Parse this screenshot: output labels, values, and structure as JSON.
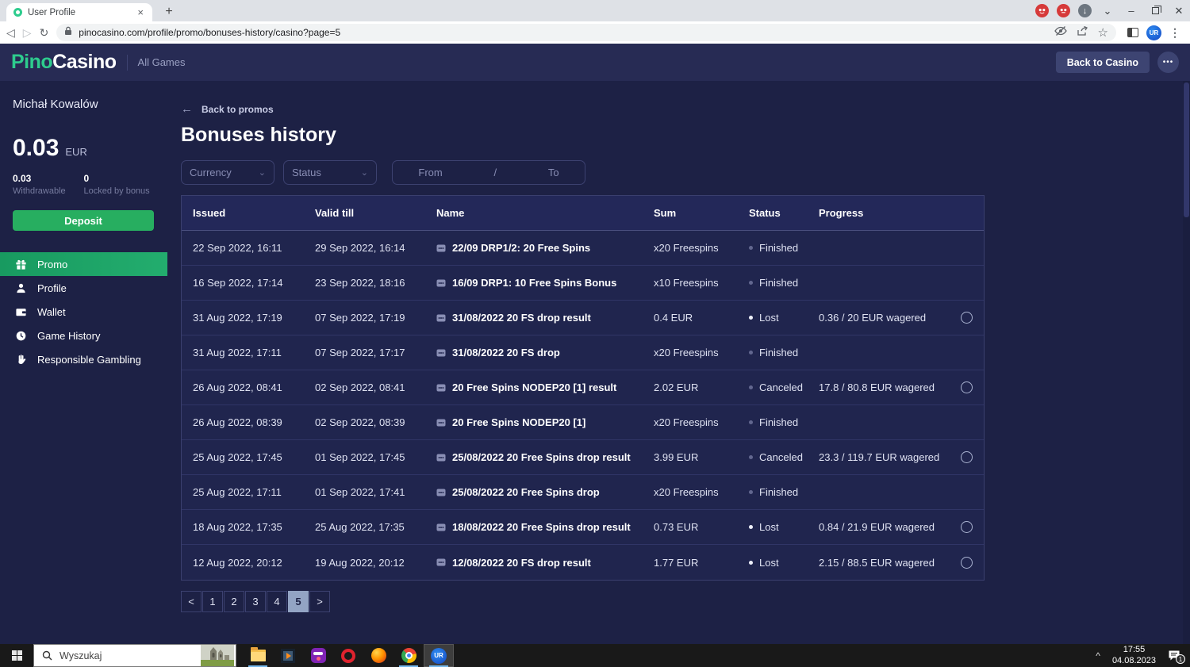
{
  "browser": {
    "tab_title": "User Profile",
    "url": "pinocasino.com/profile/promo/bonuses-history/casino?page=5"
  },
  "icons": {
    "tab_close": "×",
    "new_tab": "+",
    "tab_search_chevron": "⌄",
    "window_minimize": "–",
    "window_close": "✕",
    "back": "◁",
    "forward": "▷",
    "reload": "↻",
    "download_arrow": "↓",
    "star": "☆",
    "kebab": "⋮",
    "more_dots": "•••",
    "back_arrow": "←",
    "chevron_down": "⌄",
    "tray_chevron": "^"
  },
  "header": {
    "logo_part1": "Pino",
    "logo_part2": "Casino",
    "all_games": "All Games",
    "back_to_casino": "Back to Casino"
  },
  "sidebar": {
    "user_name": "Michał Kowalów",
    "balance": "0.03",
    "currency": "EUR",
    "withdrawable_value": "0.03",
    "withdrawable_label": "Withdrawable",
    "locked_value": "0",
    "locked_label": "Locked by bonus",
    "deposit_label": "Deposit",
    "nav": [
      {
        "label": "Promo",
        "icon": "gift-icon",
        "active": true
      },
      {
        "label": "Profile",
        "icon": "user-icon",
        "active": false
      },
      {
        "label": "Wallet",
        "icon": "wallet-icon",
        "active": false
      },
      {
        "label": "Game History",
        "icon": "clock-icon",
        "active": false
      },
      {
        "label": "Responsible Gambling",
        "icon": "hand-icon",
        "active": false
      }
    ]
  },
  "main": {
    "back_link": "Back to promos",
    "title": "Bonuses history",
    "filters": {
      "currency_placeholder": "Currency",
      "status_placeholder": "Status",
      "from_placeholder": "From",
      "separator": "/",
      "to_placeholder": "To"
    }
  },
  "table": {
    "headers": [
      "Issued",
      "Valid till",
      "Name",
      "Sum",
      "Status",
      "Progress"
    ],
    "rows": [
      {
        "issued": "22 Sep 2022, 16:11",
        "valid_till": "29 Sep 2022, 16:14",
        "name": "22/09 DRP1/2: 20 Free Spins",
        "sum": "x20 Freespins",
        "status": "Finished",
        "status_type": "finished",
        "progress": "",
        "has_ring": false
      },
      {
        "issued": "16 Sep 2022, 17:14",
        "valid_till": "23 Sep 2022, 18:16",
        "name": "16/09 DRP1: 10 Free Spins Bonus",
        "sum": "x10 Freespins",
        "status": "Finished",
        "status_type": "finished",
        "progress": "",
        "has_ring": false
      },
      {
        "issued": "31 Aug 2022, 17:19",
        "valid_till": "07 Sep 2022, 17:19",
        "name": "31/08/2022 20 FS drop result",
        "sum": "0.4 EUR",
        "status": "Lost",
        "status_type": "lost",
        "progress": "0.36 / 20 EUR wagered",
        "has_ring": true
      },
      {
        "issued": "31 Aug 2022, 17:11",
        "valid_till": "07 Sep 2022, 17:17",
        "name": "31/08/2022 20 FS drop",
        "sum": "x20 Freespins",
        "status": "Finished",
        "status_type": "finished",
        "progress": "",
        "has_ring": false
      },
      {
        "issued": "26 Aug 2022, 08:41",
        "valid_till": "02 Sep 2022, 08:41",
        "name": "20 Free Spins NODEP20 [1] result",
        "sum": "2.02 EUR",
        "status": "Canceled",
        "status_type": "canceled",
        "progress": "17.8 / 80.8 EUR wagered",
        "has_ring": true
      },
      {
        "issued": "26 Aug 2022, 08:39",
        "valid_till": "02 Sep 2022, 08:39",
        "name": "20 Free Spins NODEP20 [1]",
        "sum": "x20 Freespins",
        "status": "Finished",
        "status_type": "finished",
        "progress": "",
        "has_ring": false
      },
      {
        "issued": "25 Aug 2022, 17:45",
        "valid_till": "01 Sep 2022, 17:45",
        "name": "25/08/2022 20 Free Spins drop result",
        "sum": "3.99 EUR",
        "status": "Canceled",
        "status_type": "canceled",
        "progress": "23.3 / 119.7 EUR wagered",
        "has_ring": true
      },
      {
        "issued": "25 Aug 2022, 17:11",
        "valid_till": "01 Sep 2022, 17:41",
        "name": "25/08/2022 20 Free Spins drop",
        "sum": "x20 Freespins",
        "status": "Finished",
        "status_type": "finished",
        "progress": "",
        "has_ring": false
      },
      {
        "issued": "18 Aug 2022, 17:35",
        "valid_till": "25 Aug 2022, 17:35",
        "name": "18/08/2022 20 Free Spins drop result",
        "sum": "0.73 EUR",
        "status": "Lost",
        "status_type": "lost",
        "progress": "0.84 / 21.9 EUR wagered",
        "has_ring": true
      },
      {
        "issued": "12 Aug 2022, 20:12",
        "valid_till": "19 Aug 2022, 20:12",
        "name": "12/08/2022 20 FS drop result",
        "sum": "1.77 EUR",
        "status": "Lost",
        "status_type": "lost",
        "progress": "2.15 / 88.5 EUR wagered",
        "has_ring": true
      }
    ]
  },
  "pagination": {
    "prev": "<",
    "pages": [
      "1",
      "2",
      "3",
      "4",
      "5"
    ],
    "next": ">",
    "active_page": "5"
  },
  "taskbar": {
    "search_placeholder": "Wyszukaj",
    "time": "17:55",
    "date": "04.08.2023",
    "notification_count": "1"
  },
  "colors": {
    "brand_green": "#2ecc8e",
    "deposit_green": "#27ae60",
    "active_nav_green": "#1fa467",
    "page_bg": "#1d2145",
    "header_bg": "#272b54",
    "border": "#3c4170",
    "active_page_bg": "#93a4c4"
  }
}
